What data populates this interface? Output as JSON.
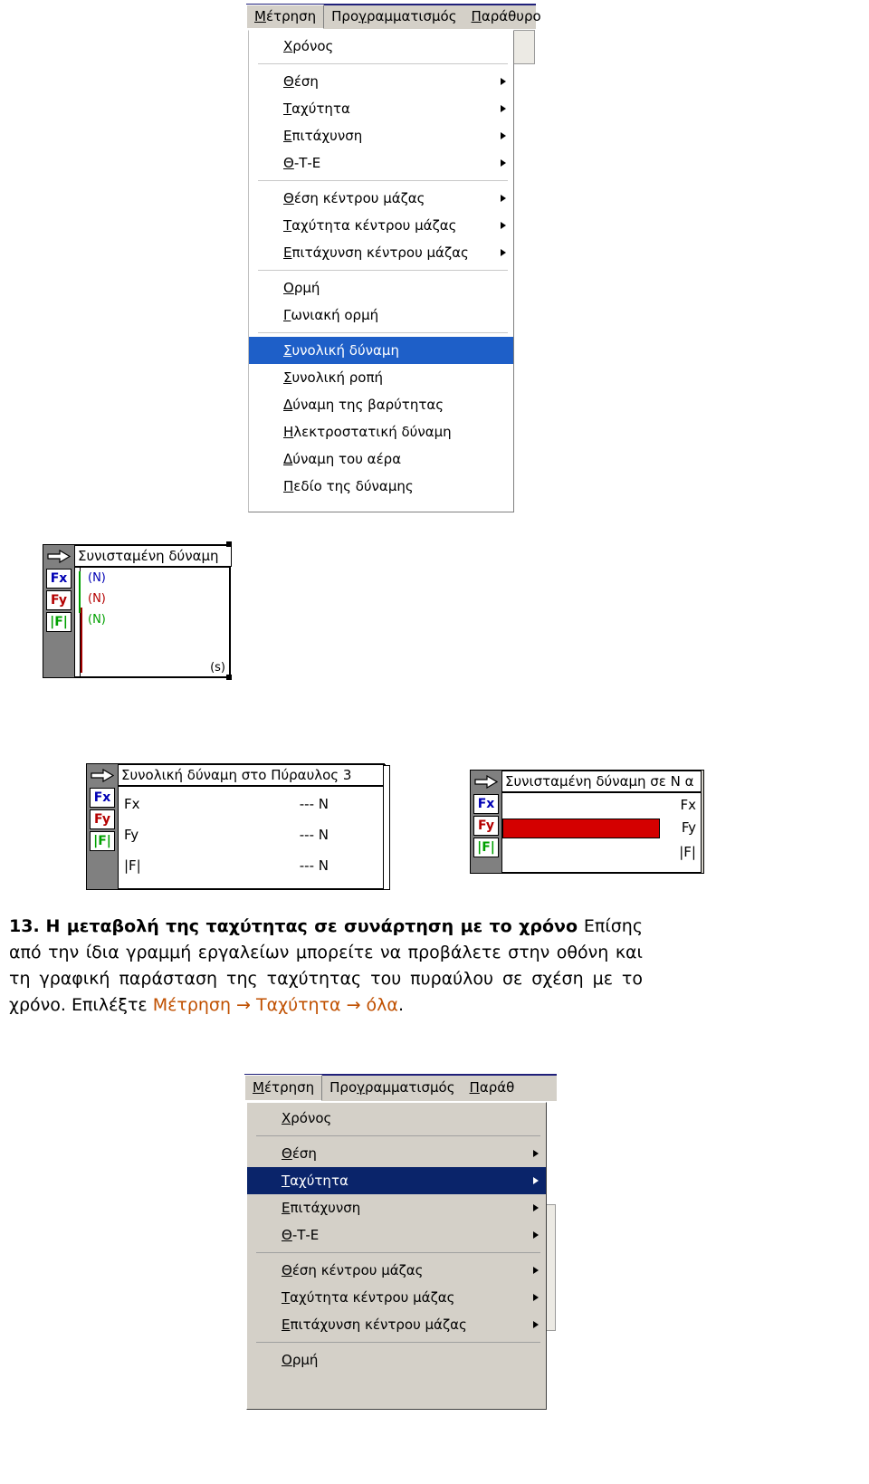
{
  "menu_top": {
    "menubar": [
      {
        "name": "metrisi",
        "label": "Μέτρηση",
        "accel": "Μ",
        "active": true
      },
      {
        "name": "programmatismos",
        "label": "Προγραμματισμός",
        "accel": "γ",
        "active": false
      },
      {
        "name": "parathyro",
        "label": "Παράθυρο",
        "accel": "Π",
        "active": false
      }
    ],
    "items": [
      {
        "label": "Χρόνος",
        "submenu": false,
        "selected": false,
        "sep_after": true
      },
      {
        "label": "Θέση",
        "submenu": true,
        "selected": false
      },
      {
        "label": "Ταχύτητα",
        "submenu": true,
        "selected": false
      },
      {
        "label": "Επιτάχυνση",
        "submenu": true,
        "selected": false
      },
      {
        "label": "Θ-Τ-Ε",
        "submenu": true,
        "selected": false,
        "sep_after": true
      },
      {
        "label": "Θέση κέντρου μάζας",
        "submenu": true,
        "selected": false
      },
      {
        "label": "Ταχύτητα κέντρου μάζας",
        "submenu": true,
        "selected": false
      },
      {
        "label": "Επιτάχυνση κέντρου μάζας",
        "submenu": true,
        "selected": false,
        "sep_after": true
      },
      {
        "label": "Ορμή",
        "submenu": false,
        "selected": false
      },
      {
        "label": "Γωνιακή ορμή",
        "submenu": false,
        "selected": false,
        "sep_after": true
      },
      {
        "label": "Συνολική δύναμη",
        "submenu": false,
        "selected": true
      },
      {
        "label": "Συνολική ροπή",
        "submenu": false,
        "selected": false
      },
      {
        "label": "Δύναμη της βαρύτητας",
        "submenu": false,
        "selected": false
      },
      {
        "label": "Ηλεκτροστατική δύναμη",
        "submenu": false,
        "selected": false
      },
      {
        "label": "Δύναμη του αέρα",
        "submenu": false,
        "selected": false
      },
      {
        "label": "Πεδίο της δύναμης",
        "submenu": false,
        "selected": false
      }
    ]
  },
  "widget_graph": {
    "title": "Συνισταμένη δύναμη",
    "arrow_icon": "right-arrow-icon",
    "buttons": [
      {
        "name": "fx-button",
        "label": "Fx"
      },
      {
        "name": "fy-button",
        "label": "Fy"
      },
      {
        "name": "fabs-button",
        "label": "|F|"
      }
    ],
    "units": [
      {
        "label": "(N)",
        "color": "blue"
      },
      {
        "label": "(N)",
        "color": "red"
      },
      {
        "label": "(N)",
        "color": "green"
      }
    ],
    "x_unit": "(s)"
  },
  "widget_values": {
    "title": "Συνολική δύναμη στο Πύραυλος 3",
    "arrow_icon": "right-arrow-icon",
    "buttons": [
      {
        "name": "fx-button",
        "label": "Fx"
      },
      {
        "name": "fy-button",
        "label": "Fy"
      },
      {
        "name": "fabs-button",
        "label": "|F|"
      }
    ],
    "rows": [
      {
        "label": "Fx",
        "value": "--- N"
      },
      {
        "label": "Fy",
        "value": "--- N"
      },
      {
        "label": "|F|",
        "value": "--- N"
      }
    ]
  },
  "widget_bars": {
    "title": "Συνισταμένη δύναμη σε N α",
    "arrow_icon": "right-arrow-icon",
    "buttons": [
      {
        "name": "fx-button",
        "label": "Fx"
      },
      {
        "name": "fy-button",
        "label": "Fy"
      },
      {
        "name": "fabs-button",
        "label": "|F|"
      }
    ],
    "right_labels": [
      "Fx",
      "Fy",
      "|F|"
    ],
    "bar_color": "#d40000"
  },
  "body_text": {
    "number": "13.",
    "heading": "Η μεταβολή της ταχύτητας σε συνάρτηση με το χρόνο",
    "paragraph": "Επίσης από την ίδια γραμμή εργαλείων μπορείτε να προβάλετε στην οθόνη και τη γραφική παράσταση της ταχύτητας του πυραύλου σε σχέση με το χρόνο.",
    "instruction_prefix": "Επιλέξτε ",
    "instruction_path": "Μέτρηση → Ταχύτητα → όλα",
    "instruction_suffix": ".",
    "accent_color": "#c05000"
  },
  "menu_bottom": {
    "menubar": [
      {
        "name": "metrisi",
        "label": "Μέτρηση",
        "accel": "Μ",
        "active": true
      },
      {
        "name": "programmatismos",
        "label": "Προγραμματισμός",
        "accel": "γ",
        "active": false
      },
      {
        "name": "parathyro",
        "label": "Παράθ",
        "accel": "Π",
        "active": false
      }
    ],
    "items": [
      {
        "label": "Χρόνος",
        "submenu": false,
        "selected": false,
        "sep_after": true
      },
      {
        "label": "Θέση",
        "submenu": true,
        "selected": false
      },
      {
        "label": "Ταχύτητα",
        "submenu": true,
        "selected": true
      },
      {
        "label": "Επιτάχυνση",
        "submenu": true,
        "selected": false
      },
      {
        "label": "Θ-Τ-Ε",
        "submenu": true,
        "selected": false,
        "sep_after": true
      },
      {
        "label": "Θέση κέντρου μάζας",
        "submenu": true,
        "selected": false
      },
      {
        "label": "Ταχύτητα κέντρου μάζας",
        "submenu": true,
        "selected": false
      },
      {
        "label": "Επιτάχυνση κέντρου μάζας",
        "submenu": true,
        "selected": false,
        "sep_after": true
      },
      {
        "label": "Ορμή",
        "submenu": false,
        "selected": false
      }
    ]
  }
}
